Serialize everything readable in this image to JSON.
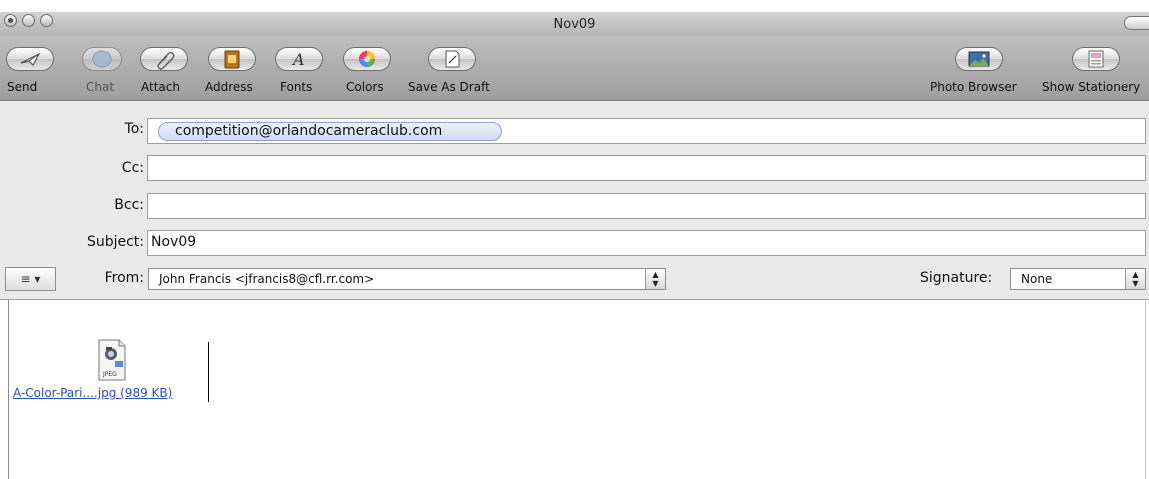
{
  "window": {
    "title": "Nov09"
  },
  "toolbar": {
    "buttons": [
      {
        "label": "Send",
        "icon": "send-icon"
      },
      {
        "label": "Chat",
        "icon": "chat-icon"
      },
      {
        "label": "Attach",
        "icon": "paperclip-icon"
      },
      {
        "label": "Address",
        "icon": "address-book-icon"
      },
      {
        "label": "Fonts",
        "icon": "fonts-icon"
      },
      {
        "label": "Colors",
        "icon": "color-wheel-icon"
      },
      {
        "label": "Save As Draft",
        "icon": "draft-icon"
      },
      {
        "label": "Photo Browser",
        "icon": "photo-icon"
      },
      {
        "label": "Show Stationery",
        "icon": "stationery-icon"
      }
    ]
  },
  "header": {
    "to_label": "To:",
    "to_recipient": "competition@orlandocameraclub.com",
    "cc_label": "Cc:",
    "cc_value": "",
    "bcc_label": "Bcc:",
    "bcc_value": "",
    "subject_label": "Subject:",
    "subject_value": "Nov09",
    "from_label": "From:",
    "from_value": "John Francis <jfrancis8@cfl.rr.com>",
    "signature_label": "Signature:",
    "signature_value": "None",
    "menu_glyph": "≡ ▾"
  },
  "message": {
    "attachment_badge": "JPEG",
    "attachment_label": "A-Color-Pari....jpg (989 KB)"
  }
}
